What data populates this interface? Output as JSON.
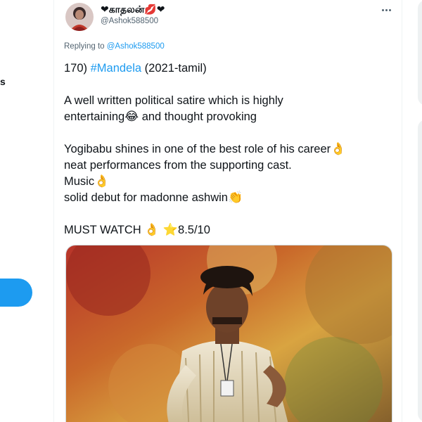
{
  "sidebar": {
    "partial_text": "s",
    "button_color": "#1d9bf0"
  },
  "tweet": {
    "author_name": "❤காதலன்💋❤",
    "author_handle": "@Ashok588500",
    "replying_prefix": "Replying to ",
    "replying_handle": "@Ashok588500",
    "line1_prefix": "170) ",
    "line1_hashtag": "#Mandela",
    "line1_suffix": " (2021-tamil)",
    "line2": "A well written political satire which is highly",
    "line3_text": "entertaining",
    "line3_emoji": "😂",
    "line3_suffix": " and thought provoking",
    "line4_text": "Yogibabu shines in one of the best role of his career",
    "line4_emoji": "👌",
    "line5": "neat performances from the supporting cast.",
    "line6_text": "Music",
    "line6_emoji": "👌",
    "line7_text": "solid debut for madonne ashwin",
    "line7_emoji": "👏",
    "line8_text": "MUST WATCH ",
    "line8_emoji1": "👌",
    "line8_emoji2": " ⭐",
    "line8_rating": "8.5/10"
  },
  "colors": {
    "link": "#1d9bf0",
    "text": "#0f1419",
    "muted": "#536471"
  },
  "icons": {
    "more": "more-horizontal-icon",
    "avatar": "avatar"
  }
}
